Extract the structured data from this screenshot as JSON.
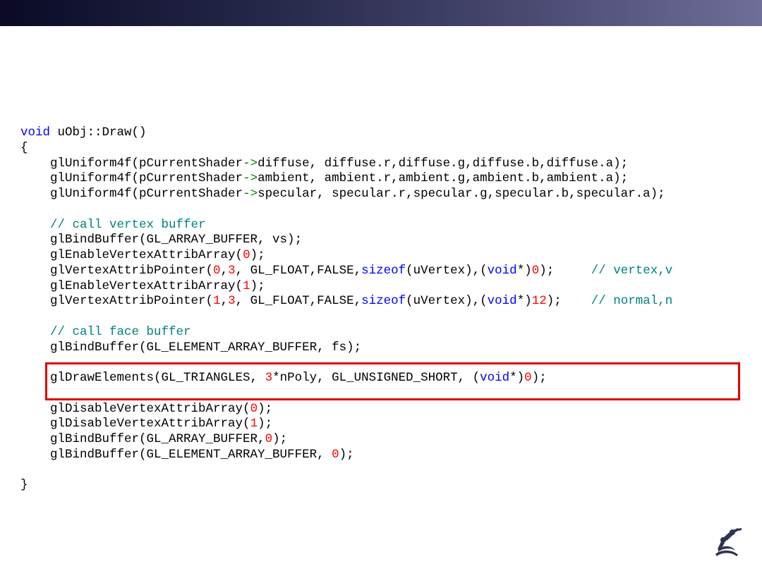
{
  "slide": {
    "top_bar_gradient": [
      "#0a0a26",
      "#262849",
      "#4a4a72",
      "#6f6e98"
    ],
    "highlight_color": "#e00000",
    "highlighted_line_index": 16
  },
  "syntax_colors": {
    "keyword": "#0000ff",
    "number": "#ff0000",
    "comment": "#008080",
    "arrow": "#008000",
    "text": "#000000"
  },
  "code": {
    "lines": [
      [
        {
          "t": "void",
          "c": "kw"
        },
        {
          "t": " uObj::Draw()",
          "c": ""
        }
      ],
      [
        {
          "t": "{",
          "c": ""
        }
      ],
      [
        {
          "t": "    glUniform4f(pCurrentShader",
          "c": ""
        },
        {
          "t": "->",
          "c": "arrow"
        },
        {
          "t": "diffuse, diffuse.r,diffuse.g,diffuse.b,diffuse.a);",
          "c": ""
        }
      ],
      [
        {
          "t": "    glUniform4f(pCurrentShader",
          "c": ""
        },
        {
          "t": "->",
          "c": "arrow"
        },
        {
          "t": "ambient, ambient.r,ambient.g,ambient.b,ambient.a);",
          "c": ""
        }
      ],
      [
        {
          "t": "    glUniform4f(pCurrentShader",
          "c": ""
        },
        {
          "t": "->",
          "c": "arrow"
        },
        {
          "t": "specular, specular.r,specular.g,specular.b,specular.a);",
          "c": ""
        }
      ],
      [
        {
          "t": "",
          "c": ""
        }
      ],
      [
        {
          "t": "    ",
          "c": ""
        },
        {
          "t": "// call vertex buffer",
          "c": "cmt"
        }
      ],
      [
        {
          "t": "    glBindBuffer(GL_ARRAY_BUFFER, vs);",
          "c": ""
        }
      ],
      [
        {
          "t": "    glEnableVertexAttribArray(",
          "c": ""
        },
        {
          "t": "0",
          "c": "num"
        },
        {
          "t": ");",
          "c": ""
        }
      ],
      [
        {
          "t": "    glVertexAttribPointer(",
          "c": ""
        },
        {
          "t": "0",
          "c": "num"
        },
        {
          "t": ",",
          "c": ""
        },
        {
          "t": "3",
          "c": "num"
        },
        {
          "t": ", GL_FLOAT,FALSE,",
          "c": ""
        },
        {
          "t": "sizeof",
          "c": "kw"
        },
        {
          "t": "(uVertex),(",
          "c": ""
        },
        {
          "t": "void",
          "c": "kw"
        },
        {
          "t": "*)",
          "c": ""
        },
        {
          "t": "0",
          "c": "num"
        },
        {
          "t": ");     ",
          "c": ""
        },
        {
          "t": "// vertex,v",
          "c": "cmt"
        }
      ],
      [
        {
          "t": "    glEnableVertexAttribArray(",
          "c": ""
        },
        {
          "t": "1",
          "c": "num"
        },
        {
          "t": ");",
          "c": ""
        }
      ],
      [
        {
          "t": "    glVertexAttribPointer(",
          "c": ""
        },
        {
          "t": "1",
          "c": "num"
        },
        {
          "t": ",",
          "c": ""
        },
        {
          "t": "3",
          "c": "num"
        },
        {
          "t": ", GL_FLOAT,FALSE,",
          "c": ""
        },
        {
          "t": "sizeof",
          "c": "kw"
        },
        {
          "t": "(uVertex),(",
          "c": ""
        },
        {
          "t": "void",
          "c": "kw"
        },
        {
          "t": "*)",
          "c": ""
        },
        {
          "t": "12",
          "c": "num"
        },
        {
          "t": ");    ",
          "c": ""
        },
        {
          "t": "// normal,n",
          "c": "cmt"
        }
      ],
      [
        {
          "t": "",
          "c": ""
        }
      ],
      [
        {
          "t": "    ",
          "c": ""
        },
        {
          "t": "// call face buffer",
          "c": "cmt"
        }
      ],
      [
        {
          "t": "    glBindBuffer(GL_ELEMENT_ARRAY_BUFFER, fs);",
          "c": ""
        }
      ],
      [
        {
          "t": "",
          "c": ""
        }
      ],
      [
        {
          "t": "    glDrawElements(GL_TRIANGLES, ",
          "c": ""
        },
        {
          "t": "3",
          "c": "num"
        },
        {
          "t": "*nPoly, GL_UNSIGNED_SHORT, (",
          "c": ""
        },
        {
          "t": "void",
          "c": "kw"
        },
        {
          "t": "*)",
          "c": ""
        },
        {
          "t": "0",
          "c": "num"
        },
        {
          "t": ");",
          "c": ""
        }
      ],
      [
        {
          "t": "",
          "c": ""
        }
      ],
      [
        {
          "t": "    glDisableVertexAttribArray(",
          "c": ""
        },
        {
          "t": "0",
          "c": "num"
        },
        {
          "t": ");",
          "c": ""
        }
      ],
      [
        {
          "t": "    glDisableVertexAttribArray(",
          "c": ""
        },
        {
          "t": "1",
          "c": "num"
        },
        {
          "t": ");",
          "c": ""
        }
      ],
      [
        {
          "t": "    glBindBuffer(GL_ARRAY_BUFFER,",
          "c": ""
        },
        {
          "t": "0",
          "c": "num"
        },
        {
          "t": ");",
          "c": ""
        }
      ],
      [
        {
          "t": "    glBindBuffer(GL_ELEMENT_ARRAY_BUFFER, ",
          "c": ""
        },
        {
          "t": "0",
          "c": "num"
        },
        {
          "t": ");",
          "c": ""
        }
      ],
      [
        {
          "t": "",
          "c": ""
        }
      ],
      [
        {
          "t": "}",
          "c": ""
        }
      ]
    ]
  },
  "logo": {
    "icon": "robot-arm-logo-icon",
    "color": "#2e3552"
  }
}
